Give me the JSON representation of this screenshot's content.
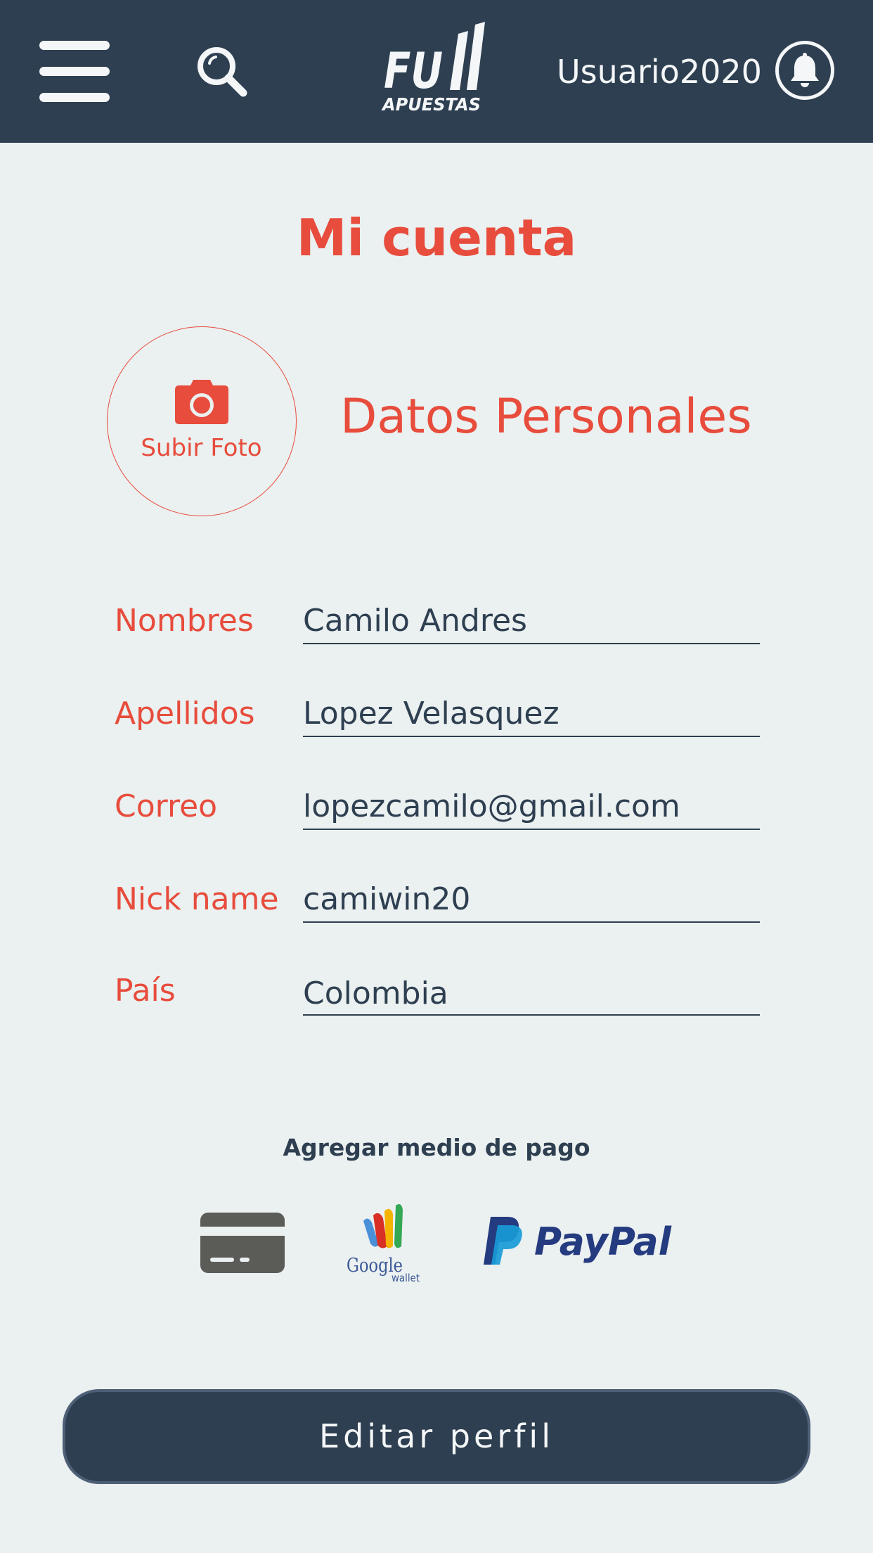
{
  "header": {
    "username": "Usuario2020",
    "logo_text": "FULL APUESTAS",
    "colors": {
      "bar": "#2e3f51",
      "icons": "#f4f6f7"
    },
    "icons": [
      "menu-icon",
      "search-icon",
      "bell-icon"
    ]
  },
  "page": {
    "title": "Mi cuenta",
    "accent_color": "#e74c3c",
    "text_color": "#2e3f51",
    "background": "#ebf0f0"
  },
  "photo": {
    "label": "Subir Foto",
    "icon": "camera-icon"
  },
  "section": {
    "title": "Datos Personales"
  },
  "fields": [
    {
      "label": "Nombres",
      "value": "Camilo Andres"
    },
    {
      "label": "Apellidos",
      "value": "Lopez Velasquez"
    },
    {
      "label": "Correo",
      "value": "lopezcamilo@gmail.com"
    },
    {
      "label": "Nick name",
      "value": "camiwin20"
    },
    {
      "label": "País",
      "value": "Colombia"
    }
  ],
  "payment": {
    "title": "Agregar medio de pago",
    "methods": [
      "card-icon",
      "google-wallet-icon",
      "paypal-icon"
    ],
    "google_wallet": {
      "brand": "Google",
      "sub": "wallet"
    },
    "paypal": {
      "brand": "PayPal"
    }
  },
  "actions": {
    "edit_label": "Editar perfil"
  }
}
